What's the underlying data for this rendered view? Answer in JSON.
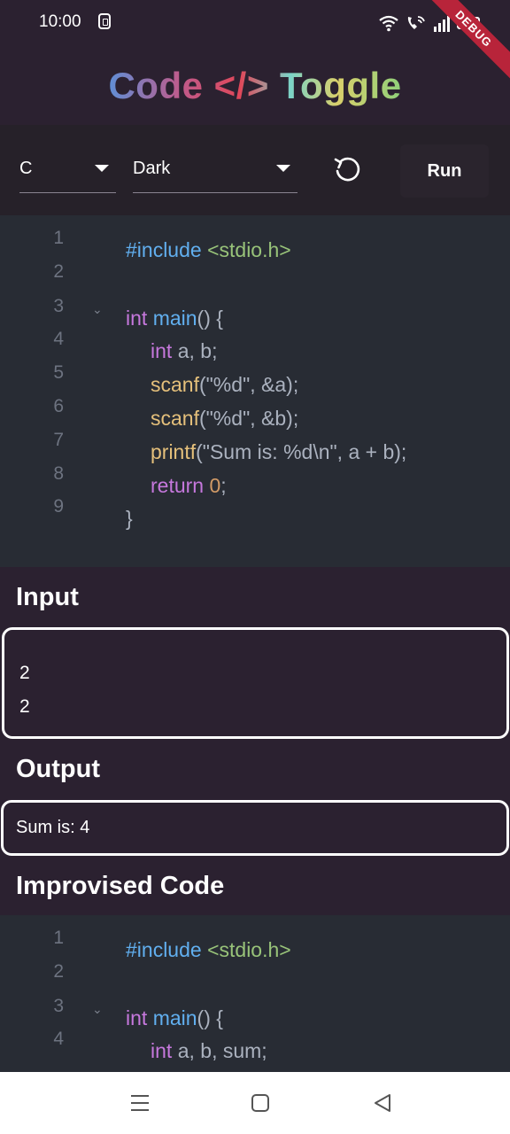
{
  "status_bar": {
    "time": "10:00",
    "debug_label": "DEBUG"
  },
  "header": {
    "title": "Code </> Toggle"
  },
  "toolbar": {
    "language_value": "C",
    "theme_value": "Dark",
    "run_label": "Run"
  },
  "editor": {
    "line_numbers": [
      "1",
      "2",
      "3",
      "4",
      "5",
      "6",
      "7",
      "8",
      "9"
    ],
    "lines": [
      "#include <stdio.h>",
      "",
      "int main() {",
      "    int a, b;",
      "    scanf(\"%d\", &a);",
      "    scanf(\"%d\", &b);",
      "    printf(\"Sum is: %d\\n\", a + b);",
      "    return 0;",
      "}"
    ]
  },
  "input_section": {
    "title": "Input",
    "lines": [
      "2",
      "2"
    ]
  },
  "output_section": {
    "title": "Output",
    "text": "Sum is: 4"
  },
  "improved_section": {
    "title": "Improvised Code",
    "line_numbers": [
      "1",
      "2",
      "3",
      "4"
    ],
    "lines": [
      "#include <stdio.h>",
      "",
      "int main() {",
      "    int a, b, sum;"
    ]
  },
  "colors": {
    "background": "#2b2130",
    "editor_bg": "#282c34",
    "keyword": "#c678dd",
    "function": "#61afef",
    "string": "#98c379",
    "call": "#e5c07b",
    "number": "#d19a66"
  },
  "icons": {
    "reset": "rotate-ccw-icon",
    "fold": "chevron-down-icon",
    "nav_menu": "menu-icon",
    "nav_home": "square-icon",
    "nav_back": "triangle-back-icon"
  }
}
